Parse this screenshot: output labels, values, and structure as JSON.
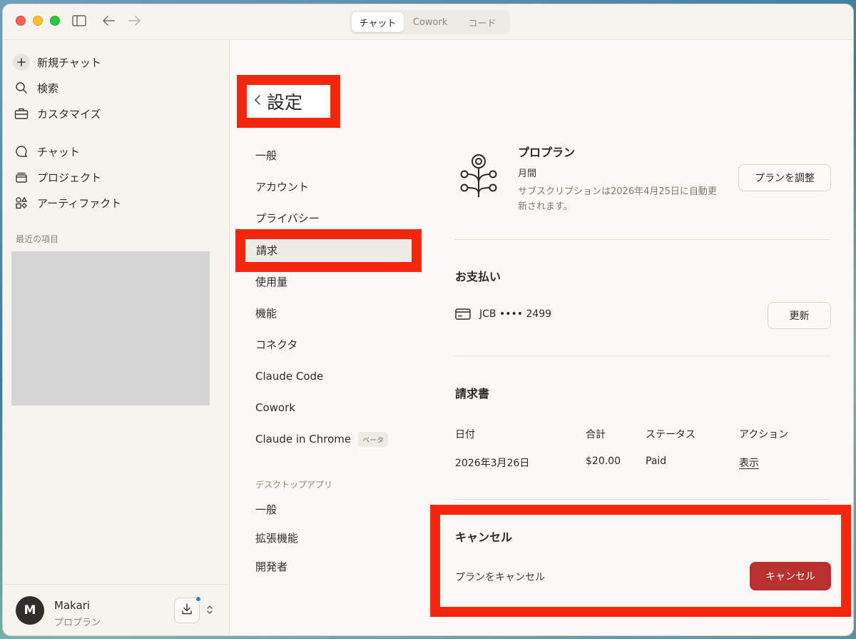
{
  "titlebar": {
    "tabs": [
      {
        "label": "チャット",
        "active": true
      },
      {
        "label": "Cowork",
        "active": false
      },
      {
        "label": "コード",
        "active": false
      }
    ]
  },
  "sidebar": {
    "primary": [
      {
        "label": "新規チャット",
        "icon": "plus-icon"
      },
      {
        "label": "検索",
        "icon": "search-icon"
      },
      {
        "label": "カスタマイズ",
        "icon": "toolbox-icon"
      }
    ],
    "secondary": [
      {
        "label": "チャット",
        "icon": "chat-bubble-icon"
      },
      {
        "label": "プロジェクト",
        "icon": "folder-stack-icon"
      },
      {
        "label": "アーティファクト",
        "icon": "artifacts-icon"
      }
    ],
    "recent_label": "最近の項目",
    "user": {
      "initial": "M",
      "name": "Makari",
      "plan": "プロプラン"
    }
  },
  "settings": {
    "title": "設定",
    "nav": [
      {
        "label": "一般",
        "active": false
      },
      {
        "label": "アカウント",
        "active": false
      },
      {
        "label": "プライバシー",
        "active": false
      },
      {
        "label": "請求",
        "active": true
      },
      {
        "label": "使用量",
        "active": false
      },
      {
        "label": "機能",
        "active": false
      },
      {
        "label": "コネクタ",
        "active": false
      },
      {
        "label": "Claude Code",
        "active": false
      },
      {
        "label": "Cowork",
        "active": false
      },
      {
        "label": "Claude in Chrome",
        "active": false,
        "badge": "ベータ"
      }
    ],
    "desktop_section": "デスクトップアプリ",
    "desktop_nav": [
      {
        "label": "一般"
      },
      {
        "label": "拡張機能"
      },
      {
        "label": "開発者"
      }
    ]
  },
  "billing": {
    "plan": {
      "name": "プロプラン",
      "cycle": "月間",
      "renewal": "サブスクリプションは2026年4月25日に自動更新されます。",
      "adjust_button": "プランを調整"
    },
    "payment": {
      "title": "お支払い",
      "card": "JCB •••• 2499",
      "update_button": "更新"
    },
    "invoices": {
      "title": "請求書",
      "headers": [
        "日付",
        "合計",
        "ステータス",
        "アクション"
      ],
      "rows": [
        {
          "date": "2026年3月26日",
          "total": "$20.00",
          "status": "Paid",
          "action": "表示"
        }
      ]
    },
    "cancel": {
      "title": "キャンセル",
      "description": "プランをキャンセル",
      "button": "キャンセル"
    }
  },
  "colors": {
    "highlight": "#f4270d",
    "danger": "#b8312f",
    "background": "#faf9f5"
  }
}
